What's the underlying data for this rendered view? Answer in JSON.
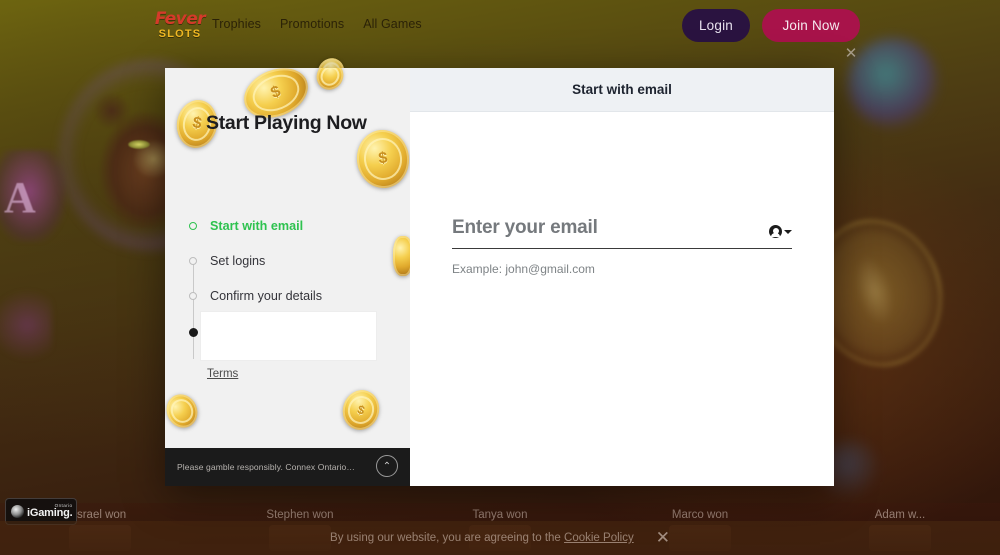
{
  "header": {
    "logo_top": "Fever",
    "logo_bottom": "SLOTS",
    "nav": [
      {
        "label": "Trophies"
      },
      {
        "label": "Promotions"
      },
      {
        "label": "All Games"
      }
    ],
    "login_label": "Login",
    "join_label": "Join Now",
    "close_icon": "✕"
  },
  "modal": {
    "promo": {
      "title": "Start Playing Now",
      "steps": [
        {
          "label": "Start with email",
          "state": "active"
        },
        {
          "label": "Set logins",
          "state": "pending"
        },
        {
          "label": "Confirm your details",
          "state": "pending"
        },
        {
          "label": "",
          "state": "filled"
        }
      ],
      "terms_label": "Terms",
      "footer_note": "Please gamble responsibly. Connex Ontario: 1-...",
      "scroll_top_icon": "⌃"
    },
    "form": {
      "header_title": "Start with email",
      "email_placeholder": "Enter your email",
      "email_value": "",
      "email_hint": "Example: john@gmail.com",
      "autofill_icon": "contact-autofill-icon"
    }
  },
  "winners": [
    {
      "name": "Israel won"
    },
    {
      "name": "Stephen won"
    },
    {
      "name": "Tanya won"
    },
    {
      "name": "Marco won"
    },
    {
      "name": "Adam w..."
    }
  ],
  "igaming": {
    "region": "Ontario",
    "name": "iGaming."
  },
  "cookie": {
    "text_before": "By using our website, you are agreeing to the ",
    "link": "Cookie Policy",
    "close_icon": "✕"
  },
  "colors": {
    "accent_green": "#2ec24f",
    "join_now": "#a8134a",
    "login": "#2a1340",
    "logo_red": "#d43a2a",
    "logo_gold": "#f0b824",
    "form_header_bg": "#eef1f4",
    "promo_bg": "#f1f1f1"
  }
}
